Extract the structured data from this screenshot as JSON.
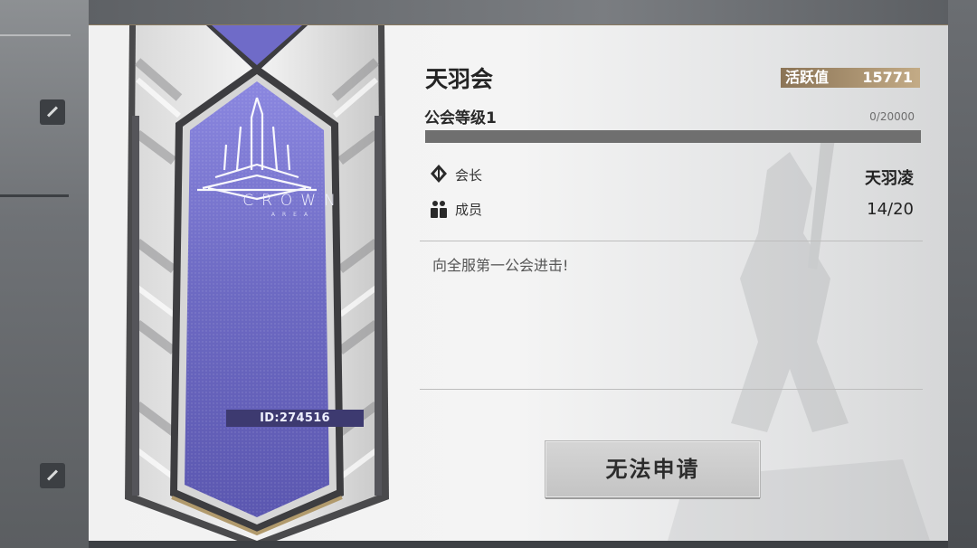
{
  "guild": {
    "name": "天羽会",
    "activity_label": "活跃值",
    "activity_value": "15771",
    "level_label": "公会等级1",
    "exp_text": "0/20000",
    "exp_progress": 0,
    "leader_label": "会长",
    "leader_name": "天羽凌",
    "members_label": "成员",
    "members_value": "14/20",
    "motto": "向全服第一公会进击!",
    "id_text": "ID:274516"
  },
  "emblem": {
    "logo_text": "CROWN",
    "logo_sub": "AREA"
  },
  "actions": {
    "apply_label": "无法申请"
  },
  "icons": {
    "leader": "leader-emblem-icon",
    "members": "members-icon"
  },
  "colors": {
    "banner_purple": "#7673c9",
    "activity_badge": "#8b7456",
    "exp_bar": "#6f6f6f"
  }
}
